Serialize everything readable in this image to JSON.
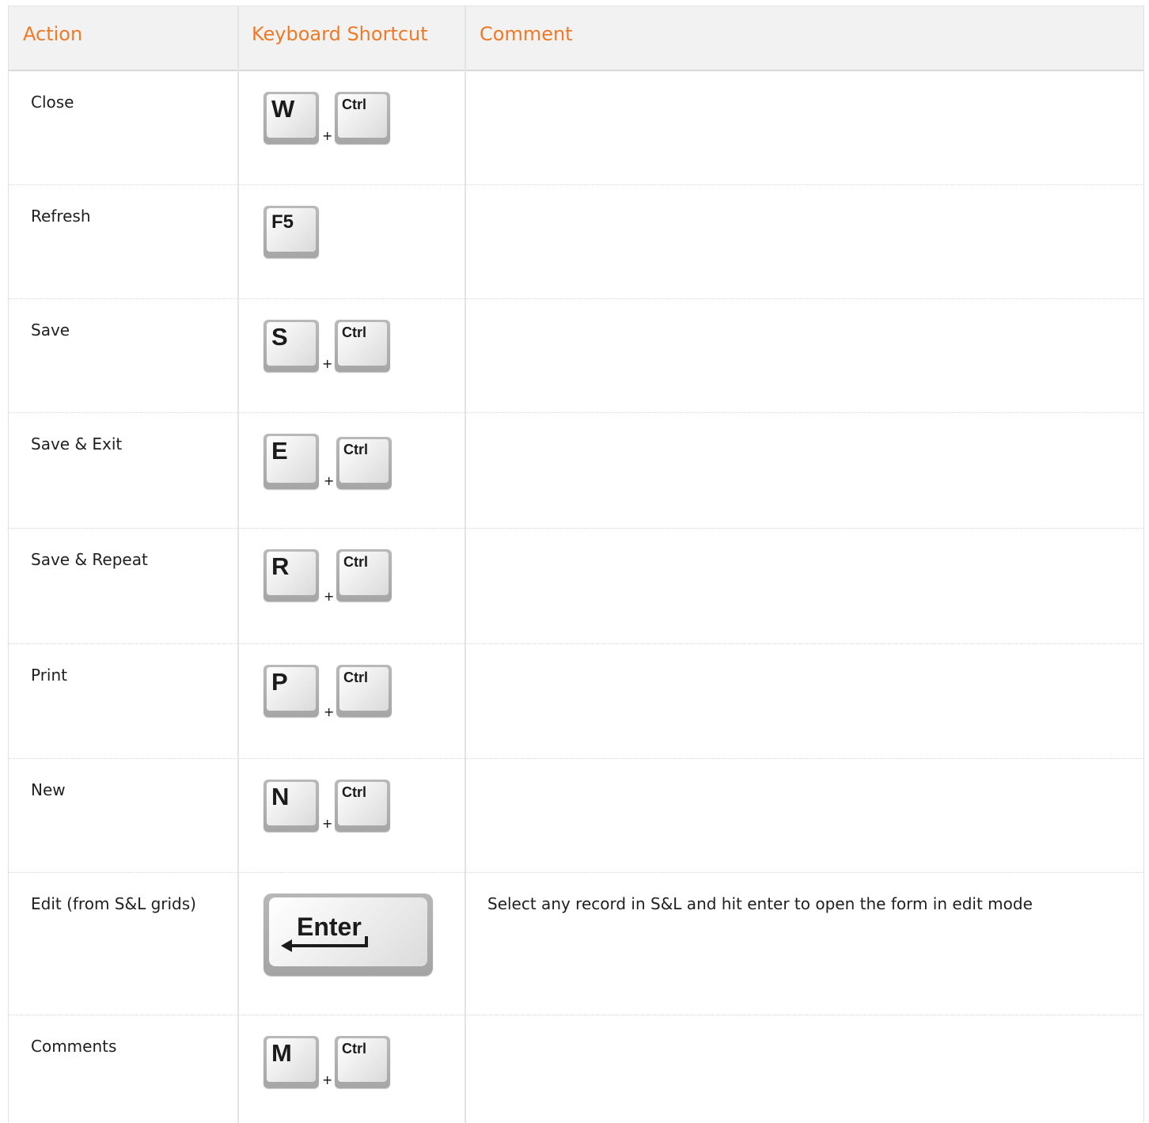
{
  "headers": {
    "action": "Action",
    "shortcut": "Keyboard Shortcut",
    "comment": "Comment"
  },
  "rows": [
    {
      "action": "Close",
      "keys": [
        "W",
        "Ctrl"
      ],
      "plus": "+",
      "comment": ""
    },
    {
      "action": "Refresh",
      "keys": [
        "F5"
      ],
      "plus": "",
      "comment": ""
    },
    {
      "action": "Save",
      "keys": [
        "S",
        "Ctrl"
      ],
      "plus": "+",
      "comment": ""
    },
    {
      "action": "Save & Exit",
      "keys": [
        "E",
        "Ctrl"
      ],
      "plus": "+",
      "comment": ""
    },
    {
      "action": "Save & Repeat",
      "keys": [
        "R",
        "Ctrl"
      ],
      "plus": "+",
      "comment": ""
    },
    {
      "action": "Print",
      "keys": [
        "P",
        "Ctrl"
      ],
      "plus": "+",
      "comment": ""
    },
    {
      "action": "New",
      "keys": [
        "N",
        "Ctrl"
      ],
      "plus": "+",
      "comment": ""
    },
    {
      "action": "Edit (from S&L grids)",
      "keys": [
        "Enter"
      ],
      "plus": "",
      "comment": "Select any record in S&L and hit enter to open the form in edit mode"
    },
    {
      "action": "Comments",
      "keys": [
        "M",
        "Ctrl"
      ],
      "plus": "+",
      "comment": ""
    }
  ],
  "colors": {
    "header_text": "#ee7a27",
    "header_bg": "#f2f2f2"
  }
}
